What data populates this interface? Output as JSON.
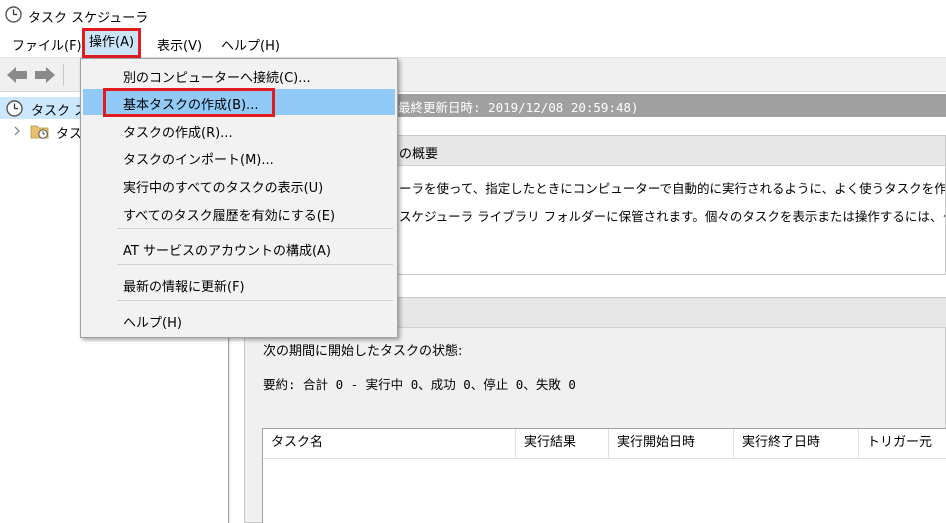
{
  "window": {
    "title": "タスク スケジューラ",
    "icon": "clock-icon"
  },
  "menubar": {
    "items": [
      "ファイル(F)",
      "操作(A)",
      "表示(V)",
      "ヘルプ(H)"
    ],
    "highlight_color": "#e21b23"
  },
  "toolbar": {
    "icons": [
      "back-arrow-icon",
      "forward-arrow-icon"
    ]
  },
  "tree": {
    "root_label": "タスク ス",
    "library_label": "タス"
  },
  "summary": {
    "header_text": "最終更新日時: 2019/12/08 20:59:48)",
    "overview_title": "の概要",
    "overview_line1": "ーラを使って、指定したときにコンピューターで自動的に実行されるように、よく使うタスクを作成し管",
    "overview_line2": "スケジューラ ライブラリ フォルダーに保管されます。個々のタスクを表示または操作するには、タスク"
  },
  "status": {
    "caption": "次の期間に開始したタスクの状態:",
    "summary": "要約: 合計 0 - 実行中 0、成功 0、停止 0、失敗 0",
    "columns": [
      "タスク名",
      "実行結果",
      "実行開始日時",
      "実行終了日時",
      "トリガー元"
    ]
  },
  "dropdown": {
    "items": [
      "別のコンピューターへ接続(C)...",
      "基本タスクの作成(B)...",
      "タスクの作成(R)...",
      "タスクのインポート(M)...",
      "実行中のすべてのタスクの表示(U)",
      "すべてのタスク履歴を有効にする(E)",
      "AT サービスのアカウントの構成(A)",
      "最新の情報に更新(F)",
      "ヘルプ(H)"
    ],
    "selected_color": "#91c9f7"
  }
}
